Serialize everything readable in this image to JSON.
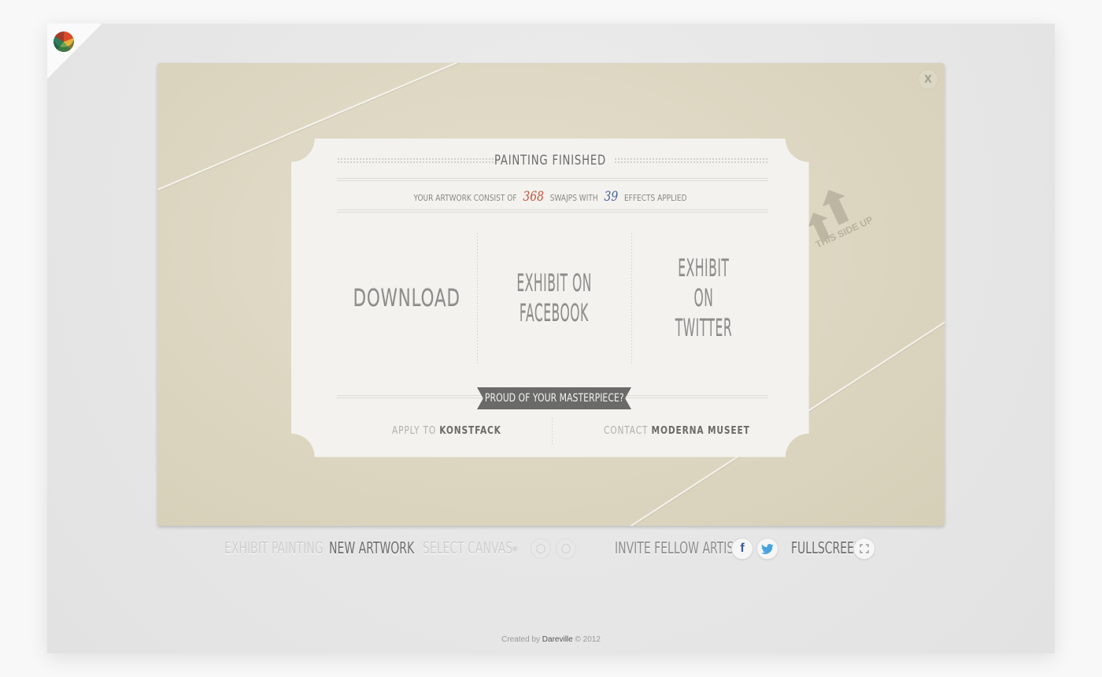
{
  "board": {
    "close_label": "X",
    "this_side_up": "THIS SIDE UP"
  },
  "ticket": {
    "title": "PAINTING FINISHED",
    "stats": {
      "prefix": "YOUR ARTWORK CONSIST OF",
      "swaps": "368",
      "middle": "SWAJPS WITH",
      "effects": "39",
      "suffix": "EFFECTS APPLIED"
    },
    "actions": {
      "download": "DOWNLOAD",
      "facebook_line1": "EXHIBIT ON",
      "facebook_line2": "FACEBOOK",
      "twitter_line1": "EXHIBIT",
      "twitter_line2": "ON TWITTER"
    },
    "ribbon": "PROUD OF YOUR MASTERPIECE?",
    "apply": {
      "prefix": "APPLY TO",
      "target": "KONSTFACK"
    },
    "contact": {
      "prefix": "CONTACT",
      "target": "MODERNA MUSEET"
    }
  },
  "toolbar": {
    "exhibit_painting": "EXHIBIT PAINTING",
    "new_artwork": "NEW ARTWORK",
    "select_canvas": "SELECT CANVAS",
    "invite": "INVITE FELLOW ARTISTS",
    "fullscreen": "FULLSCREEN",
    "facebook_glyph": "f"
  },
  "footer": {
    "prefix": "Created by",
    "brand": "Dareville",
    "suffix": "© 2012"
  },
  "colors": {
    "accent_red": "#c0533a",
    "accent_blue": "#46619a",
    "ribbon": "#6a6a68",
    "board": "#dcd6c2"
  }
}
